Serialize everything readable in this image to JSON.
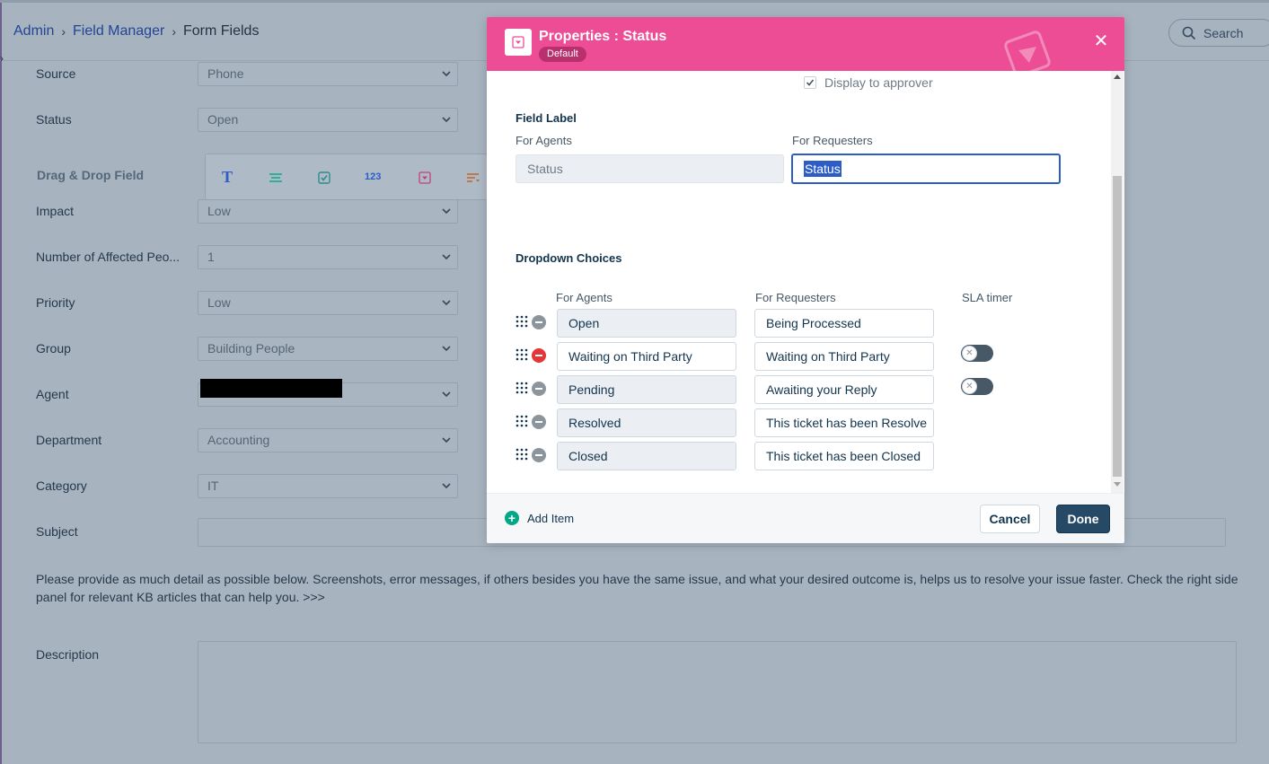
{
  "breadcrumb": {
    "admin": "Admin",
    "field_manager": "Field Manager",
    "current": "Form Fields"
  },
  "search": {
    "label": "Search"
  },
  "form": {
    "source": {
      "label": "Source",
      "value": "Phone"
    },
    "status": {
      "label": "Status",
      "value": "Open"
    },
    "drag_drop_label": "Drag & Drop Field",
    "impact": {
      "label": "Impact",
      "value": "Low"
    },
    "affected": {
      "label": "Number of Affected Peo...",
      "value": "1"
    },
    "priority": {
      "label": "Priority",
      "value": "Low"
    },
    "group": {
      "label": "Group",
      "value": "Building People"
    },
    "agent": {
      "label": "Agent",
      "value": ""
    },
    "department": {
      "label": "Department",
      "value": "Accounting"
    },
    "category": {
      "label": "Category",
      "value": "IT"
    },
    "subject": {
      "label": "Subject"
    },
    "help_text": "Please provide as much detail as possible below. Screenshots, error messages, if others besides you have the same issue, and what your desired outcome is, helps us to resolve your issue faster.  Check the right side panel for relevant KB articles that can help you. >>>",
    "description": {
      "label": "Description"
    }
  },
  "toolbar": {
    "number_icon": "123"
  },
  "modal": {
    "title": "Properties : Status",
    "badge": "Default",
    "display_to_approver": "Display to approver",
    "field_label_title": "Field Label",
    "for_agents": "For Agents",
    "for_requesters": "For Requesters",
    "agent_label_value": "Status",
    "requester_label_value": "Status",
    "dropdown_title": "Dropdown Choices",
    "col_agents": "For Agents",
    "col_requesters": "For Requesters",
    "col_sla": "SLA timer",
    "choices": [
      {
        "agent": "Open",
        "requester": "Being Processed",
        "sla_toggle": false,
        "removable_highlight": false
      },
      {
        "agent": "Waiting on Third Party",
        "requester": "Waiting on Third Party",
        "sla_toggle": true,
        "sla_on": false,
        "removable_highlight": true
      },
      {
        "agent": "Pending",
        "requester": "Awaiting your Reply",
        "sla_toggle": true,
        "sla_on": false,
        "removable_highlight": false
      },
      {
        "agent": "Resolved",
        "requester": "This ticket has been Resolve",
        "sla_toggle": false,
        "removable_highlight": false
      },
      {
        "agent": "Closed",
        "requester": "This ticket has been Closed",
        "sla_toggle": false,
        "removable_highlight": false
      }
    ],
    "add_item": "Add Item",
    "cancel": "Cancel",
    "done": "Done"
  },
  "colors": {
    "header_pink": "#ec4d94",
    "primary_dark": "#264966",
    "link_blue": "#2c5cc5",
    "danger_red": "#e43538",
    "add_green": "#00a886"
  }
}
